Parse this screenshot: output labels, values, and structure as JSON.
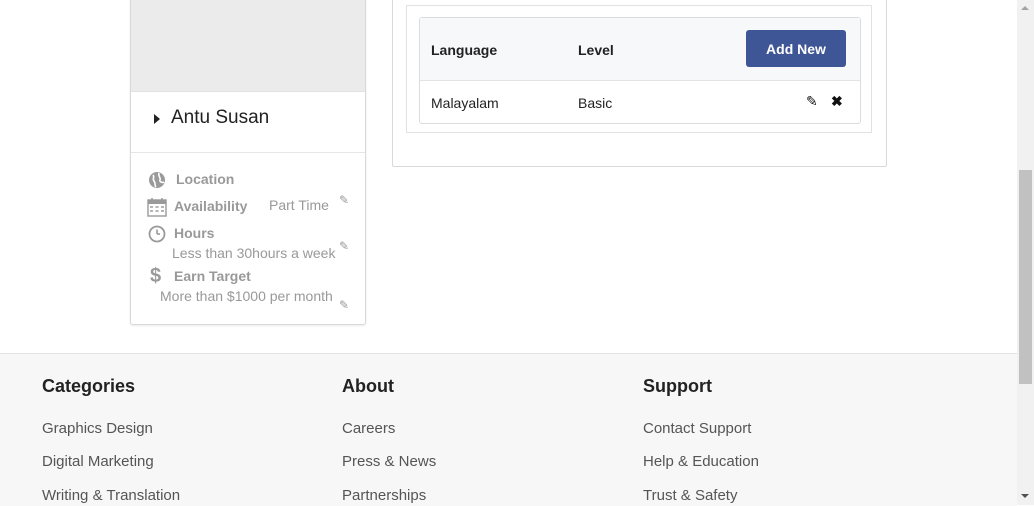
{
  "profile": {
    "name": "Antu Susan",
    "location_label": "Location",
    "availability_label": "Availability",
    "availability_value": "Part Time",
    "hours_label": "Hours",
    "hours_value": "Less than 30hours a week",
    "earn_label": "Earn Target",
    "earn_value": "More than $1000 per month"
  },
  "languages": {
    "col_language": "Language",
    "col_level": "Level",
    "add_button": "Add New",
    "rows": [
      {
        "language": "Malayalam",
        "level": "Basic"
      }
    ]
  },
  "footer": {
    "categories": {
      "title": "Categories",
      "links": [
        "Graphics Design",
        "Digital Marketing",
        "Writing & Translation"
      ]
    },
    "about": {
      "title": "About",
      "links": [
        "Careers",
        "Press & News",
        "Partnerships"
      ]
    },
    "support": {
      "title": "Support",
      "links": [
        "Contact Support",
        "Help & Education",
        "Trust & Safety"
      ]
    }
  },
  "colors": {
    "accent": "#3f5696",
    "muted_text": "#999999",
    "footer_bg": "#f7f7f7"
  }
}
